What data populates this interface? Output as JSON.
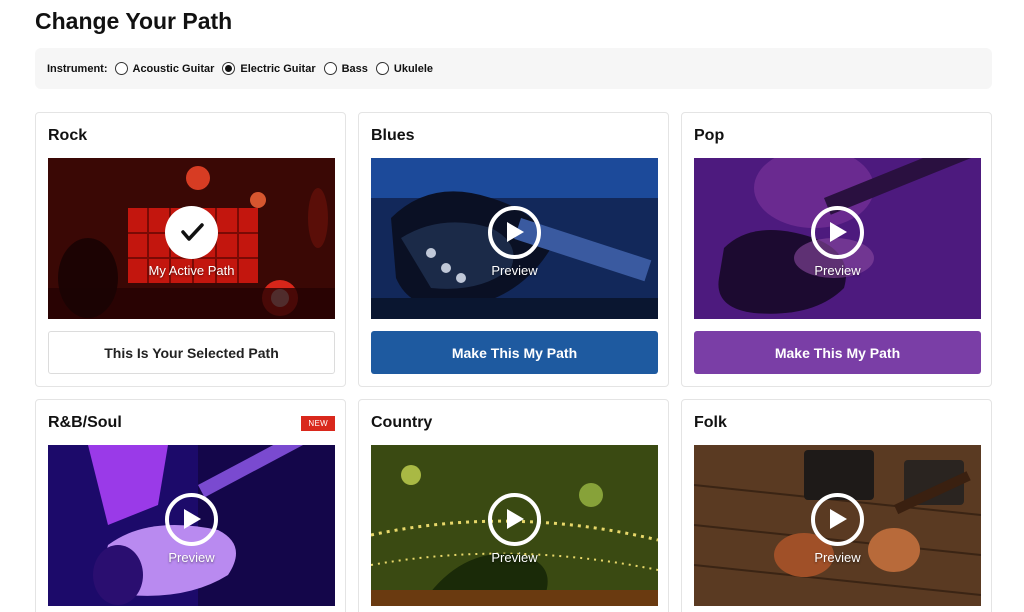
{
  "page": {
    "title": "Change Your Path"
  },
  "instrument": {
    "label": "Instrument:",
    "options": [
      {
        "label": "Acoustic Guitar",
        "checked": false
      },
      {
        "label": "Electric Guitar",
        "checked": true
      },
      {
        "label": "Bass",
        "checked": false
      },
      {
        "label": "Ukulele",
        "checked": false
      }
    ]
  },
  "cards": [
    {
      "title": "Rock",
      "caption": "My Active Path",
      "button": "This Is Your Selected Path",
      "state": "active",
      "icon": "checkmark-icon",
      "tint": "#c81e14"
    },
    {
      "title": "Blues",
      "caption": "Preview",
      "button": "Make This My Path",
      "state": "available",
      "icon": "play-icon",
      "button_color": "#1e5aa0",
      "tint": "#1b3f82"
    },
    {
      "title": "Pop",
      "caption": "Preview",
      "button": "Make This My Path",
      "state": "available",
      "icon": "play-icon",
      "button_color": "#7a3ea6",
      "tint": "#4a1a72"
    },
    {
      "title": "R&B/Soul",
      "badge": "NEW",
      "caption": "Preview",
      "icon": "play-icon",
      "tint": "#5a23c8"
    },
    {
      "title": "Country",
      "caption": "Preview",
      "icon": "play-icon",
      "tint": "#3c5a14"
    },
    {
      "title": "Folk",
      "caption": "Preview",
      "icon": "play-icon",
      "tint": "#4a3220"
    }
  ]
}
